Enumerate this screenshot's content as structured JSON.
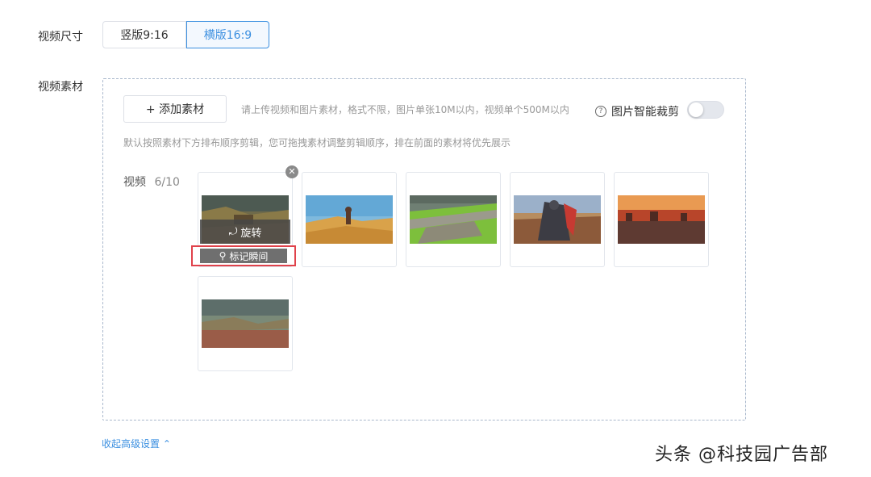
{
  "video_size": {
    "label": "视频尺寸",
    "options": [
      "竖版9:16",
      "横版16:9"
    ],
    "selected": "横版16:9"
  },
  "material": {
    "label": "视频素材",
    "add_button": "+ 添加素材",
    "upload_hint": "请上传视频和图片素材，格式不限，图片单张10M以内，视频单个500M以内",
    "smart_crop_label": "图片智能裁剪",
    "smart_crop_on": false,
    "order_hint": "默认按照素材下方排布顺序剪辑，您可拖拽素材调整剪辑顺序，排在前面的素材将优先展示",
    "video_count_label": "视频",
    "video_count": "6/10",
    "rotate_label": "旋转",
    "mark_label": "标记瞬间",
    "thumbnails": [
      {
        "name": "thumb-battle-cliff"
      },
      {
        "name": "thumb-desert-figure"
      },
      {
        "name": "thumb-castle-wall"
      },
      {
        "name": "thumb-warrior-crowd"
      },
      {
        "name": "thumb-burning-fortress"
      },
      {
        "name": "thumb-landscape-horizon"
      }
    ]
  },
  "collapse_link": "收起高级设置 ⌃",
  "watermark": "头条 @科技园广告部",
  "colors": {
    "accent": "#3b8fe0",
    "highlight_border": "#e0424b"
  }
}
